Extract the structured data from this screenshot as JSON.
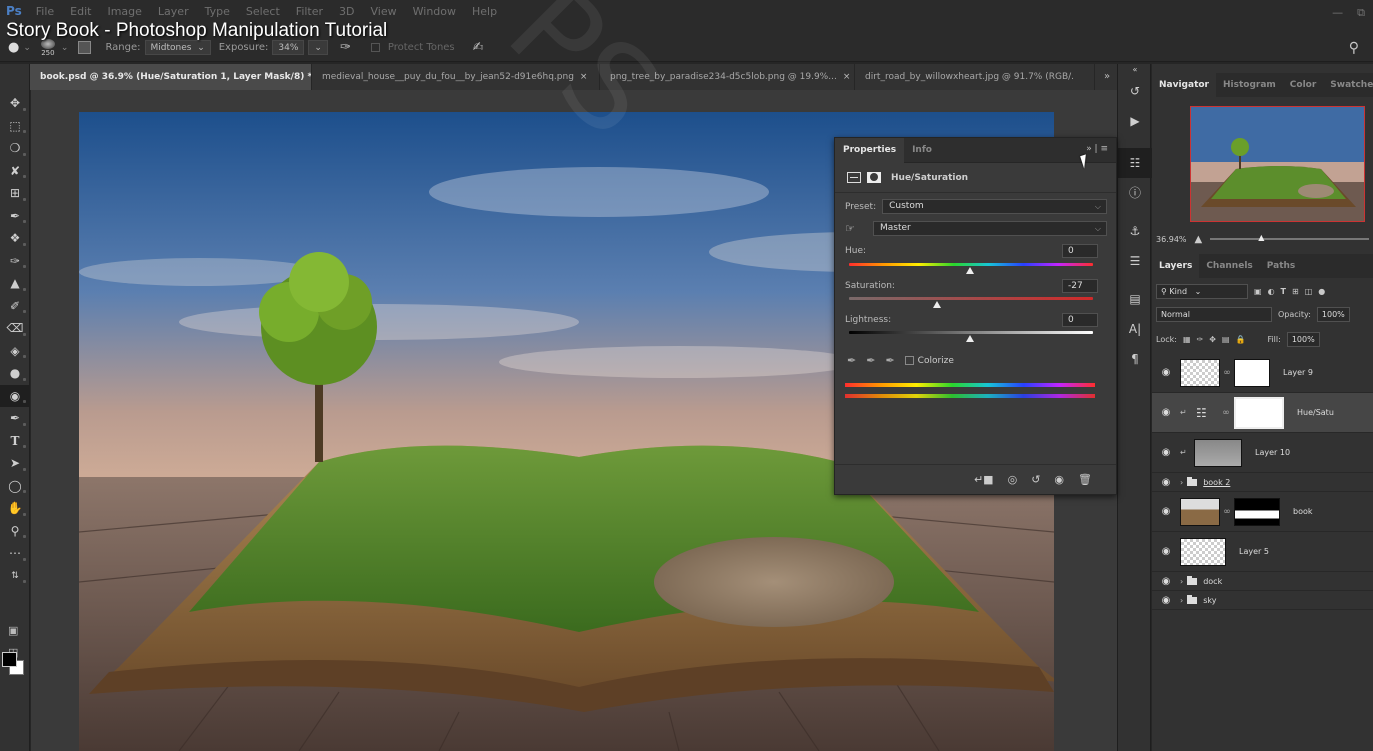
{
  "video_title": "Story Book - Photoshop Manipulation Tutorial",
  "app": {
    "logo": "Ps"
  },
  "menu": [
    "File",
    "Edit",
    "Image",
    "Layer",
    "Type",
    "Select",
    "Filter",
    "3D",
    "View",
    "Window",
    "Help"
  ],
  "options": {
    "brush_size": "250",
    "range_label": "Range:",
    "range_value": "Midtones",
    "exposure_label": "Exposure:",
    "exposure_value": "34%",
    "protect_tones": "Protect Tones"
  },
  "tabs": [
    {
      "label": "book.psd @ 36.9% (Hue/Saturation 1, Layer Mask/8) *",
      "active": true
    },
    {
      "label": "medieval_house__puy_du_fou__by_jean52-d91e6hq.png",
      "active": false
    },
    {
      "label": "png_tree_by_paradise234-d5c5lob.png @ 19.9%...",
      "active": false
    },
    {
      "label": "dirt_road_by_willowxheart.jpg @ 91.7% (RGB/.",
      "active": false
    }
  ],
  "properties": {
    "tabs": [
      "Properties",
      "Info"
    ],
    "title": "Hue/Saturation",
    "preset_label": "Preset:",
    "preset_value": "Custom",
    "channel_value": "Master",
    "hue_label": "Hue:",
    "hue_value": "0",
    "saturation_label": "Saturation:",
    "saturation_value": "-27",
    "lightness_label": "Lightness:",
    "lightness_value": "0",
    "colorize_label": "Colorize"
  },
  "navigator": {
    "tabs": [
      "Navigator",
      "Histogram",
      "Color",
      "Swatches"
    ],
    "zoom": "36.94%"
  },
  "layers": {
    "tabs": [
      "Layers",
      "Channels",
      "Paths"
    ],
    "filter_label": "Kind",
    "blend_mode": "Normal",
    "opacity_label": "Opacity:",
    "opacity_value": "100%",
    "lock_label": "Lock:",
    "fill_label": "Fill:",
    "fill_value": "100%",
    "items": [
      {
        "name": "Layer 9"
      },
      {
        "name": "Hue/Satu"
      },
      {
        "name": "Layer 10"
      },
      {
        "name": "book 2"
      },
      {
        "name": "book"
      },
      {
        "name": "Layer 5"
      },
      {
        "name": "dock"
      },
      {
        "name": "sky"
      }
    ]
  },
  "colors": {
    "accent": "#4b7fc4",
    "panel": "#323232",
    "selection": "#464646"
  }
}
